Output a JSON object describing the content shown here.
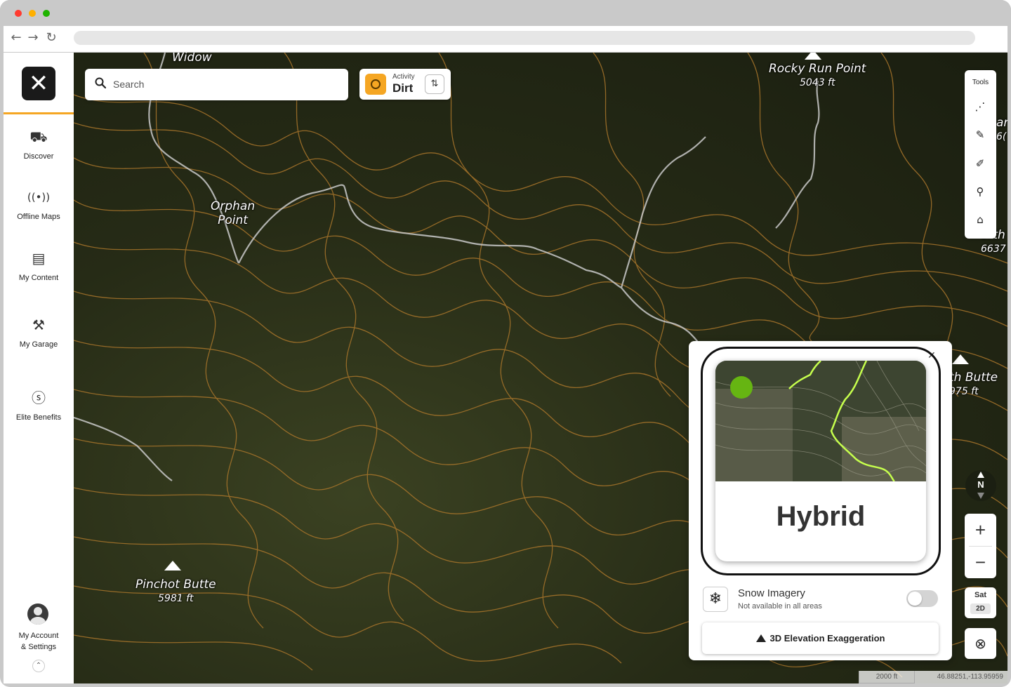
{
  "sidebar": {
    "items": [
      {
        "label": "Discover",
        "icon": "discover-icon"
      },
      {
        "label": "Offline Maps",
        "icon": "offline-maps-icon"
      },
      {
        "label": "My Content",
        "icon": "my-content-icon"
      },
      {
        "label": "My Garage",
        "icon": "my-garage-icon"
      },
      {
        "label": "Elite Benefits",
        "icon": "elite-benefits-icon"
      }
    ],
    "account_line1": "My Account",
    "account_line2": "& Settings"
  },
  "search": {
    "placeholder": "Search"
  },
  "activity": {
    "label": "Activity",
    "value": "Dirt"
  },
  "tools": {
    "label": "Tools"
  },
  "map_labels": {
    "widow": "Widow",
    "orphan_line1": "Orphan",
    "orphan_line2": "Point",
    "rocky_name": "Rocky Run Point",
    "rocky_elev": "5043 ft",
    "pinchot_name": "Pinchot Butte",
    "pinchot_elev": "5981 ft",
    "butte_name": "th Butte",
    "butte_elev": "975 ft",
    "north_fragment": "orth",
    "north_elev": "6637",
    "edge_fragment1": "ar",
    "edge_fragment2": "6("
  },
  "compass": {
    "label": "N"
  },
  "layer_toggle": {
    "top": "Sat",
    "bottom": "2D"
  },
  "scale_bar": {
    "label": "2000 ft"
  },
  "coordinates": "46.88251,-113.95959",
  "layer_panel": {
    "card_title": "Hybrid",
    "snow_title": "Snow Imagery",
    "snow_subtitle": "Not available in all areas",
    "snow_enabled": false,
    "elevation_button": "3D Elevation Exaggeration"
  },
  "colors": {
    "accent": "#f5a623",
    "contour": "#b07a2c",
    "road": "#c9c9c9",
    "trail_preview": "#c6ff4d"
  }
}
